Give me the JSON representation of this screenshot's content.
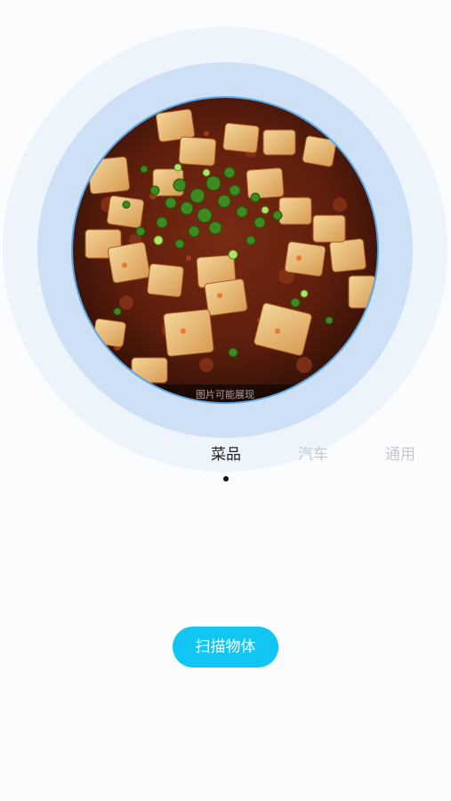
{
  "scan_view": {
    "photo_watermark": "图片可能展现"
  },
  "tabs": [
    {
      "label": "菜品",
      "active": true
    },
    {
      "label": "汽车",
      "active": false
    },
    {
      "label": "通用",
      "active": false
    }
  ],
  "scan_button": {
    "label": "扫描物体",
    "color": "#12c6f3"
  },
  "colors": {
    "ring_outer": "#eef4fc",
    "ring_mid": "#cde0f5",
    "ring_border": "#5aa9ec",
    "tab_active": "#1e1e1e",
    "tab_inactive": "#c4c8cf"
  }
}
